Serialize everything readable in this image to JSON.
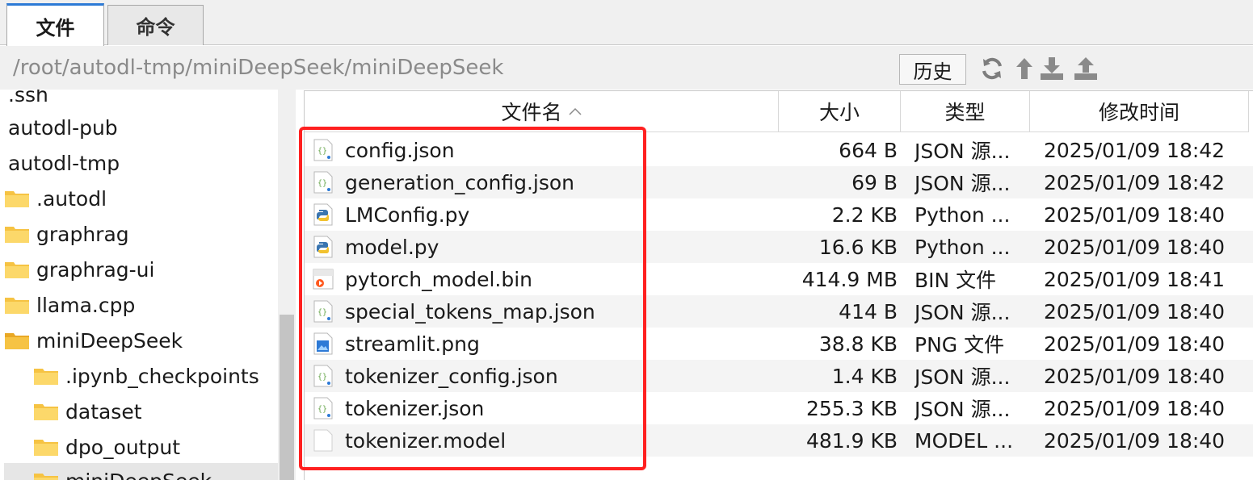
{
  "tabs": [
    {
      "label": "文件",
      "active": true
    },
    {
      "label": "命令",
      "active": false
    }
  ],
  "path": "/root/autodl-tmp/miniDeepSeek/miniDeepSeek",
  "history_label": "历史",
  "toolbar_icons": [
    "refresh-icon",
    "up-icon",
    "download-icon",
    "upload-icon"
  ],
  "tree": [
    {
      "label": ".ssh",
      "folder": false
    },
    {
      "label": "autodl-pub",
      "folder": false
    },
    {
      "label": "autodl-tmp",
      "folder": false
    },
    {
      "label": ".autodl",
      "folder": true
    },
    {
      "label": "graphrag",
      "folder": true
    },
    {
      "label": "graphrag-ui",
      "folder": true
    },
    {
      "label": "llama.cpp",
      "folder": true
    },
    {
      "label": "miniDeepSeek",
      "folder": true
    },
    {
      "label": ".ipynb_checkpoints",
      "folder": true
    },
    {
      "label": "dataset",
      "folder": true
    },
    {
      "label": "dpo_output",
      "folder": true
    },
    {
      "label": "miniDeepSeek",
      "folder": true,
      "selected": true
    }
  ],
  "columns": {
    "name": "文件名",
    "size": "大小",
    "type": "类型",
    "modified": "修改时间"
  },
  "files": [
    {
      "name": "config.json",
      "size": "664 B",
      "type": "JSON 源...",
      "modified": "2025/01/09 18:42",
      "icon": "json-file-icon"
    },
    {
      "name": "generation_config.json",
      "size": "69 B",
      "type": "JSON 源...",
      "modified": "2025/01/09 18:42",
      "icon": "json-file-icon"
    },
    {
      "name": "LMConfig.py",
      "size": "2.2 KB",
      "type": "Python ...",
      "modified": "2025/01/09 18:40",
      "icon": "python-file-icon"
    },
    {
      "name": "model.py",
      "size": "16.6 KB",
      "type": "Python ...",
      "modified": "2025/01/09 18:40",
      "icon": "python-file-icon"
    },
    {
      "name": "pytorch_model.bin",
      "size": "414.9 MB",
      "type": "BIN 文件",
      "modified": "2025/01/09 18:41",
      "icon": "video-file-icon"
    },
    {
      "name": "special_tokens_map.json",
      "size": "414 B",
      "type": "JSON 源...",
      "modified": "2025/01/09 18:40",
      "icon": "json-file-icon"
    },
    {
      "name": "streamlit.png",
      "size": "38.8 KB",
      "type": "PNG 文件",
      "modified": "2025/01/09 18:40",
      "icon": "image-file-icon"
    },
    {
      "name": "tokenizer_config.json",
      "size": "1.4 KB",
      "type": "JSON 源...",
      "modified": "2025/01/09 18:40",
      "icon": "json-file-icon"
    },
    {
      "name": "tokenizer.json",
      "size": "255.3 KB",
      "type": "JSON 源...",
      "modified": "2025/01/09 18:40",
      "icon": "json-file-icon"
    },
    {
      "name": "tokenizer.model",
      "size": "481.9 KB",
      "type": "MODEL ...",
      "modified": "2025/01/09 18:40",
      "icon": "blank-file-icon"
    }
  ],
  "colors": {
    "accent": "#2d7ad6",
    "highlight": "#ff2020",
    "folder": "#f6c343"
  }
}
